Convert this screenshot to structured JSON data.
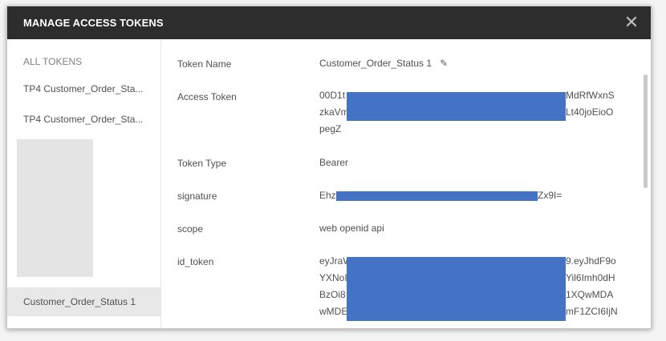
{
  "modal": {
    "title": "MANAGE ACCESS TOKENS",
    "close_icon": "close-icon"
  },
  "sidebar": {
    "heading": "ALL TOKENS",
    "items": [
      {
        "label": "TP4 Customer_Order_Sta..."
      },
      {
        "label": "TP4 Customer_Order_Sta..."
      },
      {
        "label": "Customer_Order_Status 1",
        "active": true
      }
    ]
  },
  "details": {
    "token_name": {
      "label": "Token Name",
      "value": "Customer_Order_Status 1",
      "edit_icon": "pencil-icon"
    },
    "access_token": {
      "label": "Access Token",
      "lines": [
        "00D1t",
        "MdRfWxnS",
        "zkaVm",
        "Lt40joEioO",
        "pegZ"
      ]
    },
    "token_type": {
      "label": "Token Type",
      "value": "Bearer"
    },
    "signature": {
      "label": "signature",
      "prefix": "Ehz",
      "suffix": "Zx9I="
    },
    "scope": {
      "label": "scope",
      "value": "web openid api"
    },
    "id_token": {
      "label": "id_token",
      "left": [
        "eyJraW",
        "YXNoI",
        "BzOi8",
        "wMDE"
      ],
      "right": [
        "9.eyJhdF9o",
        "Yil6Imh0dH",
        "1XQwMDA",
        "mF1ZCI6IjN"
      ]
    }
  },
  "colors": {
    "header_bg": "#2d2d2d",
    "redaction": "#4472c4",
    "active_item_bg": "#e8e8e8"
  }
}
